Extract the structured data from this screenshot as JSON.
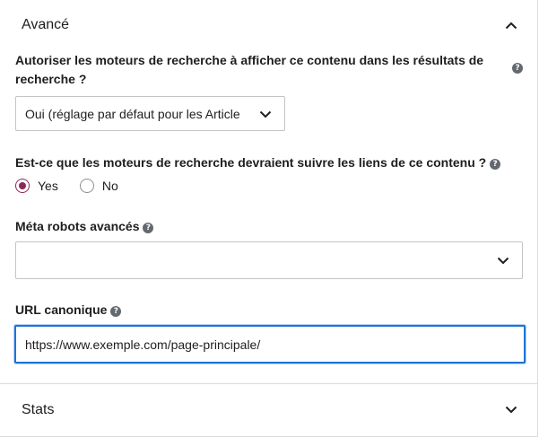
{
  "advanced": {
    "title": "Avancé",
    "allow_index_label": "Autoriser les moteurs de recherche à afficher ce contenu dans les résultats de recherche ?",
    "allow_index_value": "Oui (réglage par défaut pour les Article",
    "follow_links_label": "Est-ce que les moteurs de recherche devraient suivre les liens de ce contenu ?",
    "follow_options": [
      "Yes",
      "No"
    ],
    "follow_selected": "Yes",
    "meta_robots_label": "Méta robots avancés",
    "meta_robots_value": "",
    "canonical_label": "URL canonique",
    "canonical_value": "https://www.exemple.com/page-principale/",
    "help_glyph": "?"
  },
  "stats": {
    "title": "Stats"
  },
  "icons": {
    "collapse": "chevron-up-icon",
    "expand": "chevron-down-icon",
    "help": "help-icon"
  },
  "colors": {
    "radio_accent": "#8a2a5a",
    "focus_border": "#1e73d8",
    "border": "#c3c4c7"
  }
}
